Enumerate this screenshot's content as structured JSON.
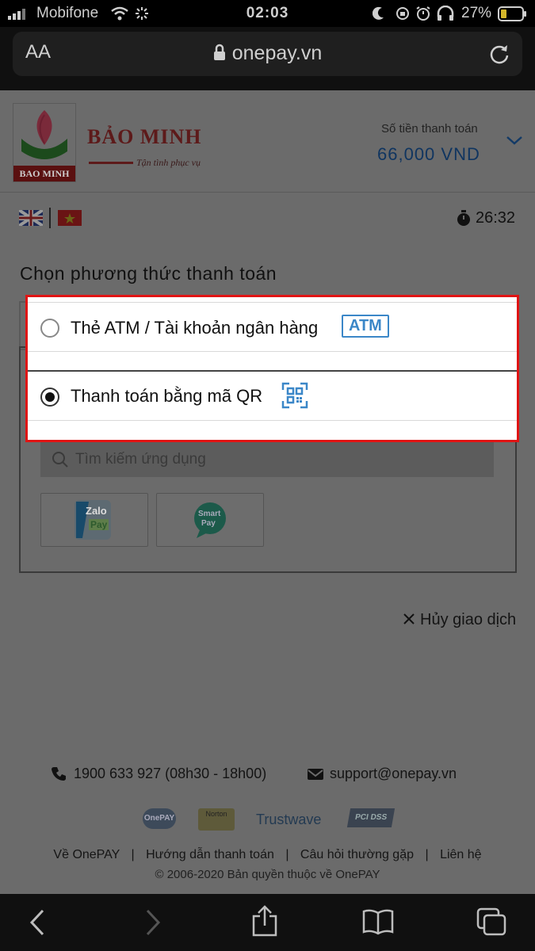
{
  "status_bar": {
    "carrier": "Mobifone",
    "time": "02:03",
    "battery_percent": "27%",
    "battery_level": 0.27,
    "icons": [
      "signal-icon",
      "wifi-icon",
      "loading-icon",
      "moon-icon",
      "rotation-lock-icon",
      "alarm-icon",
      "headphones-icon",
      "battery-icon"
    ]
  },
  "browser": {
    "text_size_label": "AA",
    "url": "onepay.vn",
    "icons": [
      "lock-icon",
      "reload-icon"
    ]
  },
  "header": {
    "brand_name": "BẢO MINH",
    "brand_tagline": "Tận tình phục vụ",
    "logo_caption": "BAO MINH",
    "amount_label": "Số tiền thanh toán",
    "amount_value": "66,000 VND"
  },
  "language": {
    "options": [
      "English",
      "Tiếng Việt"
    ]
  },
  "timer": {
    "value": "26:32"
  },
  "payment": {
    "title": "Chọn phương thức thanh toán",
    "options": [
      {
        "label": "Thẻ ATM / Tài khoản ngân hàng",
        "badge": "ATM",
        "selected": false
      },
      {
        "label": "Thanh toán bằng mã QR",
        "badge_icon": "qr-code-icon",
        "selected": true
      }
    ],
    "search_placeholder": "Tìm kiếm ứng dụng",
    "apps": [
      {
        "name": "Zalo Pay",
        "line1": "Zalo",
        "line2": "Pay"
      },
      {
        "name": "Smart Pay",
        "line1": "Smart",
        "line2": "Pay"
      }
    ],
    "cancel_label": "Hủy giao dịch"
  },
  "footer": {
    "phone": "1900 633 927 (08h30 - 18h00)",
    "email": "support@onepay.vn",
    "badges": [
      "OnePAY",
      "Norton",
      "Trustwave",
      "PCI DSS"
    ],
    "links": [
      "Về OnePAY",
      "Hướng dẫn thanh toán",
      "Câu hỏi thường gặp",
      "Liên hệ"
    ],
    "copyright": "© 2006-2020 Bản quyền thuộc về OnePAY"
  },
  "toolbar": {
    "icons": [
      "back-icon",
      "forward-icon",
      "share-icon",
      "bookmarks-icon",
      "tabs-icon"
    ]
  },
  "colors": {
    "highlight_border": "#e01414",
    "brand_blue": "#3b87c8",
    "overlay": "#6b6b6b"
  }
}
